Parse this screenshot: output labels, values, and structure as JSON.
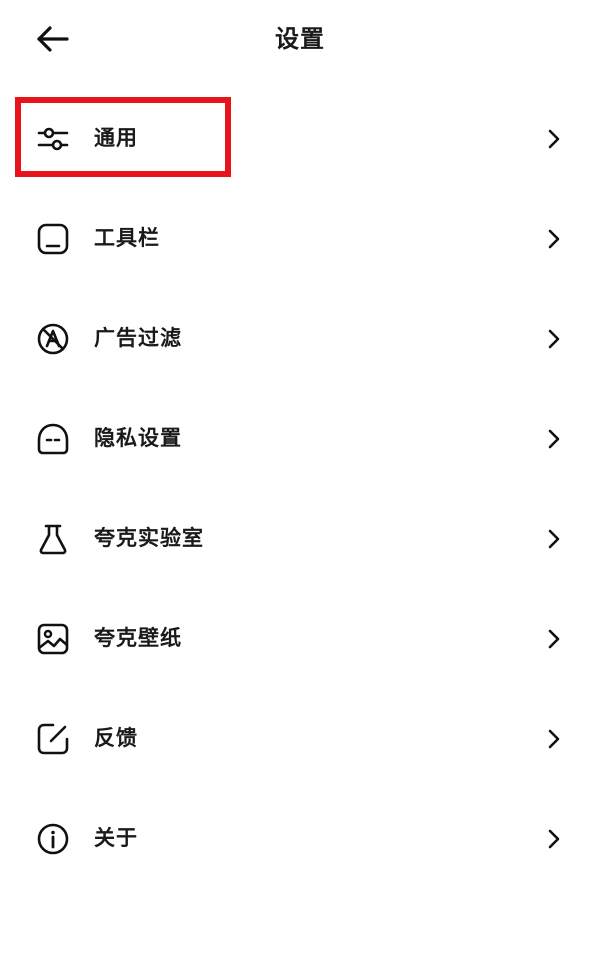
{
  "header": {
    "title": "设置"
  },
  "menu": {
    "items": [
      {
        "label": "通用",
        "icon": "sliders-icon"
      },
      {
        "label": "工具栏",
        "icon": "toolbar-icon"
      },
      {
        "label": "广告过滤",
        "icon": "ad-block-icon"
      },
      {
        "label": "隐私设置",
        "icon": "privacy-icon"
      },
      {
        "label": "夸克实验室",
        "icon": "flask-icon"
      },
      {
        "label": "夸克壁纸",
        "icon": "image-icon"
      },
      {
        "label": "反馈",
        "icon": "edit-icon"
      },
      {
        "label": "关于",
        "icon": "info-icon"
      }
    ]
  },
  "highlight": {
    "target": "通用",
    "color": "#e8141b"
  }
}
